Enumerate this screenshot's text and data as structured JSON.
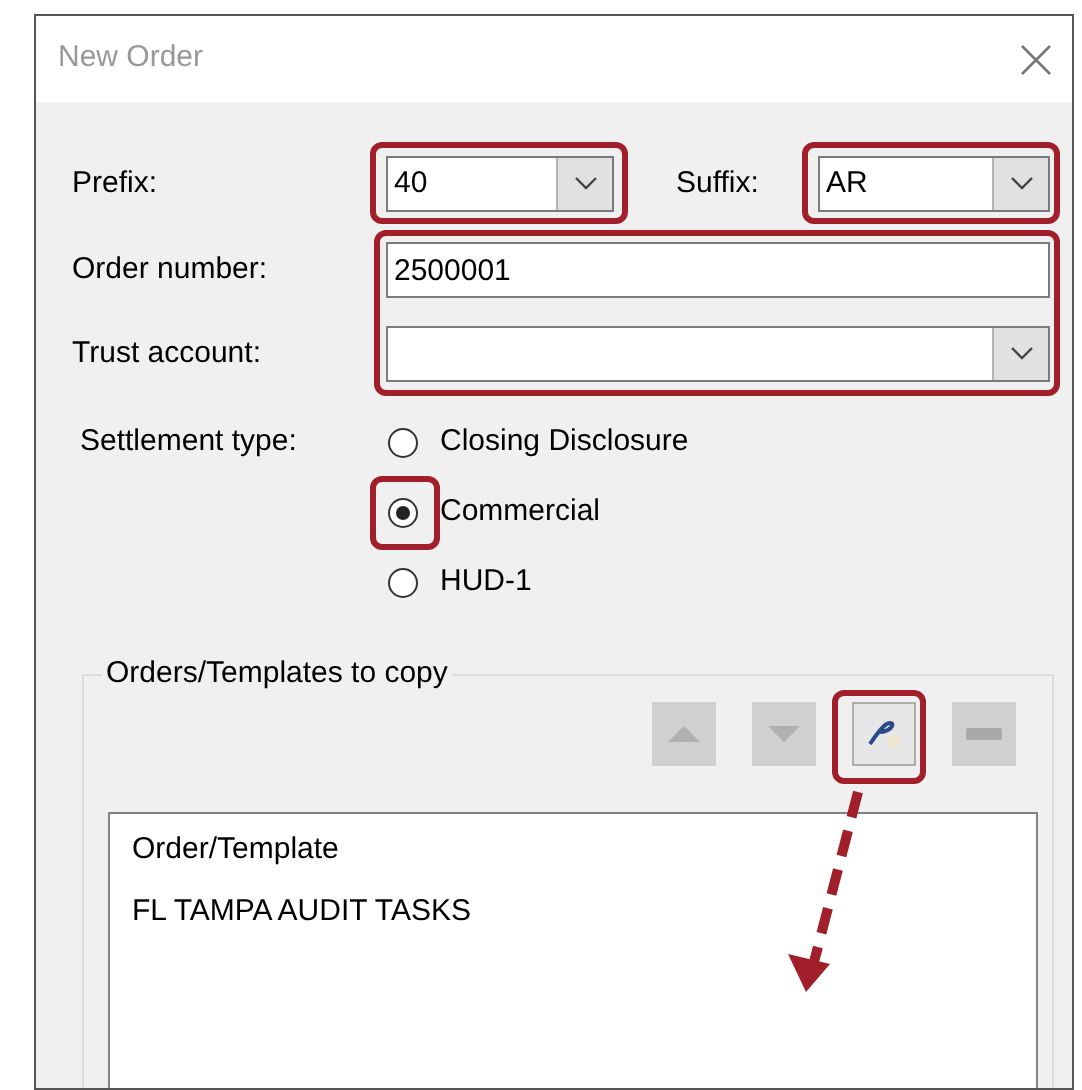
{
  "window": {
    "title": "New Order"
  },
  "prefix": {
    "label": "Prefix:",
    "value": "40",
    "highlighted": true
  },
  "suffix": {
    "label": "Suffix:",
    "value": "AR",
    "highlighted": true
  },
  "order_number": {
    "label": "Order number:",
    "value": "2500001",
    "highlighted": true
  },
  "trust_account": {
    "label": "Trust account:",
    "highlighted": true
  },
  "settlement_type": {
    "label": "Settlement type:",
    "options": [
      {
        "label": "Closing Disclosure",
        "selected": false,
        "highlighted": false
      },
      {
        "label": "Commercial",
        "selected": true,
        "highlighted": true
      },
      {
        "label": "HUD-1",
        "selected": false,
        "highlighted": false
      }
    ]
  },
  "copy_group": {
    "title": "Orders/Templates to copy",
    "buttons": [
      {
        "kind": "up",
        "disabled": true,
        "highlighted": false
      },
      {
        "kind": "down",
        "disabled": true,
        "highlighted": false
      },
      {
        "kind": "edit",
        "disabled": false,
        "highlighted": true
      },
      {
        "kind": "remove",
        "disabled": true,
        "highlighted": false
      }
    ],
    "list": {
      "header": "Order/Template",
      "items": [
        "FL TAMPA AUDIT TASKS"
      ],
      "pointer_arrow": true
    }
  }
}
